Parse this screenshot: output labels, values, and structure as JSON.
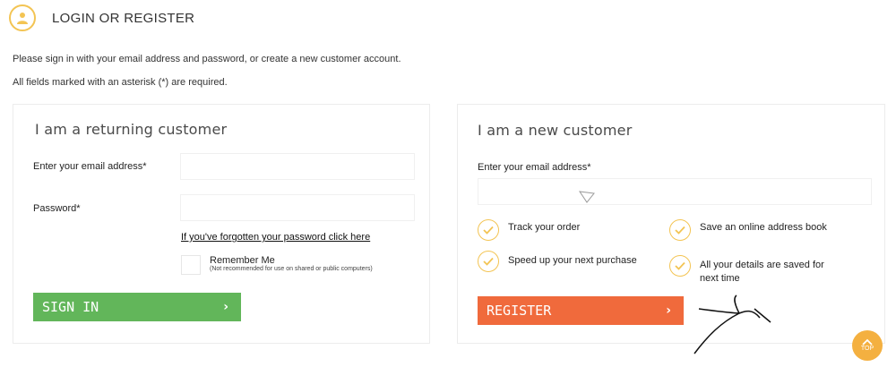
{
  "header": {
    "title": "LOGIN OR REGISTER",
    "icon": "user-icon"
  },
  "intro": {
    "line1": "Please sign in with your email address and password, or create a new customer account.",
    "line2": "All fields marked with an asterisk (*) are required."
  },
  "returning": {
    "heading": "I am a returning customer",
    "email_label": "Enter your email address*",
    "email_value": "",
    "password_label": "Password*",
    "password_value": "",
    "forgot_link": "If you've forgotten your password click here",
    "remember_label": "Remember Me",
    "remember_note": "(Not recommended for use on shared or public computers)",
    "sign_in_label": "SIGN IN"
  },
  "new_customer": {
    "heading": "I am a new customer",
    "email_label": "Enter your email address*",
    "email_value": "",
    "benefits": [
      "Track your order",
      "Save an online address book",
      "Speed up your next purchase",
      "All your details are saved for next time"
    ],
    "register_label": "REGISTER"
  },
  "scroll_top": {
    "label": "TOP"
  },
  "colors": {
    "accent": "#f3c453",
    "sign_in": "#62b65a",
    "register": "#f06a3c",
    "top": "#f4b040"
  }
}
